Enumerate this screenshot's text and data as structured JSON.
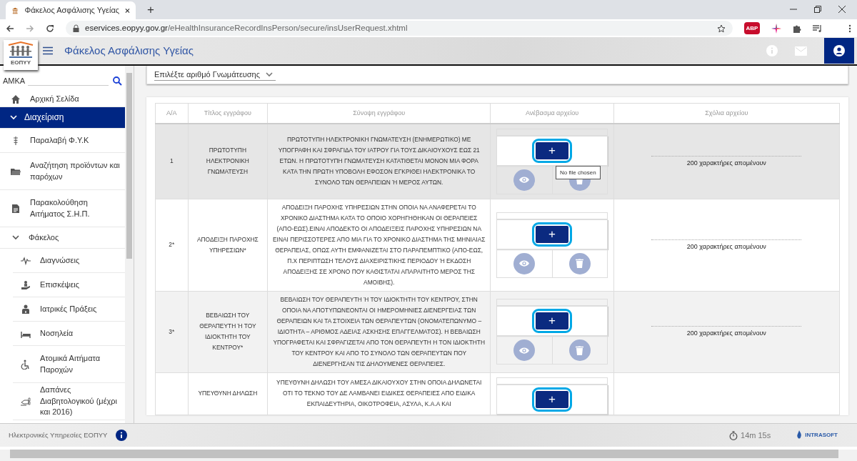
{
  "browser": {
    "tab_title": "Φάκελος Ασφάλισης Υγείας",
    "new_tab": "+",
    "url_domain": "eservices.eopyy.gov.gr",
    "url_path": "/eHealthInsuranceRecordInsPerson/secure/insUserRequest.xhtml",
    "extension_badge": "ABP"
  },
  "header": {
    "logo_text": "ΕΟΠΥΥ",
    "title": "Φάκελος Ασφάλισης Υγείας"
  },
  "sidebar": {
    "search_label": "ΑΜΚΑ",
    "items": [
      {
        "label": "Αρχική Σελίδα",
        "selected": false
      },
      {
        "label": "Διαχείριση",
        "selected": true,
        "expanded": true,
        "children": [
          {
            "label": "Παραλαβή Φ.Υ.Κ",
            "selected": false
          },
          {
            "label": "Αναζήτηση προϊόντων και παρόχων",
            "selected": false
          },
          {
            "label": "Παρακολούθηση Αιτήματος Σ.Η.Π.",
            "selected": false
          },
          {
            "label": "Φάκελος",
            "selected": false,
            "expanded": true,
            "children": [
              {
                "label": "Διαγνώσεις",
                "selected": false
              },
              {
                "label": "Επισκέψεις",
                "selected": false
              },
              {
                "label": "Ιατρικές Πράξεις",
                "selected": false
              },
              {
                "label": "Νοσηλεία",
                "selected": false
              },
              {
                "label": "Ατομικά Αιτήματα Παροχών",
                "selected": false
              },
              {
                "label": "Δαπάνες Διαβητολογικού (μέχρι και 2016)",
                "selected": false
              }
            ]
          }
        ]
      }
    ]
  },
  "referral_select": {
    "prompt": "Επιλέξτε αριθμό Γνωμάτευσης"
  },
  "table": {
    "columns": [
      "Α/Α",
      "Τίτλος εγγράφου",
      "Σύνοψη εγγράφου",
      "Ανέβασμα αρχείου",
      "Σχόλια αρχείου"
    ],
    "rows": [
      {
        "number": "1",
        "title": "ΠΡΩΤΟΤΥΠΗ ΗΛΕΚΤΡΟΝΙΚΗ ΓΝΩΜΑΤΕΥΣΗ",
        "summary": "ΠΡΩΤΟΤΥΠΗ ΗΛΕΚΤΡΟΝΙΚΗ ΓΝΩΜΑΤΕΥΣΗ (ΕΝΗΜΕΡΩΤΙΚΟ) ΜΕ ΥΠΟΓΡΑΦΗ ΚΑΙ ΣΦΡΑΓΙΔΑ ΤΟΥ ΙΑΤΡΟΥ ΓΙΑ ΤΟΥΣ ΔΙΚΑΙΟΥΧΟΥΣ ΕΩΣ 21 ΕΤΩΝ. Η ΠΡΩΤΟΤΥΠΗ ΓΝΩΜΑΤΕΥΣΗ ΚΑΤΑΤΙΘΕΤΑΙ ΜΟΝΟΝ ΜΙΑ ΦΟΡΑ ΚΑΤΑ ΤΗΝ ΠΡΩΤΗ ΥΠΟΒΟΛΗ ΕΦΟΣΟΝ ΕΓΚΡΙΘΕΙ ΗΛΕΚΤΡΟΝΙΚΑ ΤΟ ΣΥΝΟΛΟ ΤΩΝ ΘΕΡΑΠΕΙΩΝ Ή ΜΕΡΟΣ ΑΥΤΩΝ.",
        "selected": true,
        "upload": {
          "button_label": "+",
          "focused": true,
          "actions": true,
          "tooltip": "No file chosen"
        },
        "comment_counter": "200 χαρακτήρες απομένουν"
      },
      {
        "number": "2*",
        "title": "ΑΠΟΔΕΙΞΗ ΠΑΡΟΧΗΣ ΥΠΗΡΕΣΙΩΝ*",
        "summary": "ΑΠΟΔΕΙΞΗ ΠΑΡΟΧΗΣ ΥΠΗΡΕΣΙΩΝ ΣΤΗΝ ΟΠΟΙΑ ΝΑ ΑΝΑΦΕΡΕΤΑΙ ΤΟ ΧΡΟΝΙΚΟ ΔΙΑΣΤΗΜΑ ΚΑΤΑ ΤΟ ΟΠΟΙΟ ΧΟΡΗΓΗΘΗΚΑΝ ΟΙ ΘΕΡΑΠΕΙΕΣ (ΑΠΟ-ΕΩΣ).ΕΙΝΑΙ ΑΠΟΔΕΚΤΟ ΟΙ ΑΠΟΔΕΙΞΕΙΣ ΠΑΡΟΧΗΣ ΥΠΗΡΕΣΙΩΝ ΝΑ ΕΙΝΑΙ ΠΕΡΙΣΣΟΤΕΡΕΣ ΑΠΟ ΜΙΑ ΓΙΑ ΤΟ ΧΡΟΝΙΚΟ ΔΙΑΣΤΗΜΑ ΤΗΣ ΜΗΝΙΑΙΑΣ ΘΕΡΑΠΕΙΑΣ, ΟΠΩΣ ΑΥΤΗ ΕΜΦΑΝΙΖΕΤΑΙ ΣΤΟ ΠΑΡΑΠΕΜΠΤΙΚΟ (ΑΠΟ-ΕΩΣ, Π.Χ ΠΕΡΙΠΤΩΣΗ ΤΕΛΟΥΣ ΔΙΑΧΕΙΡΙΣΤΙΚΗΣ ΠΕΡΙΟΔΟΥ Ή ΕΚΔΟΣΗ ΑΠΟΔΕΙΞΗΣ ΣΕ ΧΡΟΝΟ ΠΟΥ ΚΑΘΙΣΤΑΤΑΙ ΑΠΑΡΑΙΤΗΤΟ ΜΕΡΟΣ ΤΗΣ ΑΜΟΙΒΗΣ).",
        "selected": false,
        "upload": {
          "button_label": "+",
          "focused": true,
          "actions": true
        },
        "comment_counter": "200 χαρακτήρες απομένουν"
      },
      {
        "number": "3*",
        "title": "ΒΕΒΑΙΩΣΗ ΤΟΥ ΘΕΡΑΠΕΥΤΗ Ή ΤΟΥ ΙΔΙΟΚΤΗΤΗ ΤΟΥ ΚΕΝΤΡΟΥ*",
        "summary": "ΒΕΒΑΙΩΣΗ ΤΟΥ ΘΕΡΑΠΕΥΤΗ Ή ΤΟΥ ΙΔΙΟΚΤΗΤΗ ΤΟΥ ΚΕΝΤΡΟΥ, ΣΤΗΝ ΟΠΟΙΑ ΝΑ ΑΠΟΤΥΠΩΝΕΟΝΤΑΙ ΟΙ ΗΜΕΡΟΜΗΝΙΕΣ ΔΙΕΝΕΡΓΕΙΑΣ ΤΩΝ ΘΕΡΑΠΕΙΩΝ ΚΑΙ ΤΑ ΣΤΟΙΧΕΙΑ ΤΩΝ ΘΕΡΑΠΕΥΤΩΝ (ΟΝΟΜΑΤΕΠΩΝΥΜΟ – ΙΔΙΟΤΗΤΑ – ΑΡΙΘΜΟΣ ΑΔΕΙΑΣ ΑΣΚΗΣΗΣ ΕΠΑΓΓΕΛΜΑΤΟΣ). Η ΒΕΒΑΙΩΣΗ ΥΠΟΓΡΑΦΕΤΑΙ ΚΑΙ ΣΦΡΑΓΙΖΕΤΑΙ ΑΠΟ ΤΟΝ ΘΕΡΑΠΕΥΤΗ Η ΤΟΝ ΙΔΙΟΚΤΗΤΗ ΤΟΥ ΚΕΝΤΡΟΥ ΚΑΙ ΑΠΟ ΤΟ ΣΥΝΟΛΟ ΤΩΝ ΘΕΡΑΠΕΥΤΩΝ ΠΟΥ ΔΙΕΝΕΡΓΗΣΑΝ ΤΙΣ ΔΗΛΟΥΜΕΝΕΣ ΘΕΡΑΠΕΙΕΣ.",
        "selected": false,
        "upload": {
          "button_label": "+",
          "focused": true,
          "actions": true
        },
        "comment_counter": "200 χαρακτήρες απομένουν"
      },
      {
        "title": "ΥΠΕΥΘΥΝΗ ΔΗΛΩΣΗ",
        "summary": "ΥΠΕΥΘΥΝΗ ΔΗΛΩΣΗ ΤΟΥ ΑΜΕΣΑ ΔΙΚΑΙΟΥΧΟΥ ΣΤΗΝ ΟΠΟΙΑ ΔΗΛΩΝΕΤΑΙ ΟΤΙ ΤΟ ΤΕΚΝΟ ΤΟΥ ΔΕ ΛΑΜΒΑΝΕΙ ΕΙΔΙΚΕΣ ΘΕΡΑΠΕΙΕΣ ΑΠΟ ΕΙΔΙΚΑ ΕΚΠΑΙΔΕΥΤΗΡΙΑ, ΟΙΚΟΤΡΟΦΕΙΑ, ΑΣΥΛΑ, Κ.Α.Α ΚΑΙ",
        "selected": false,
        "upload": {
          "button_label": "+",
          "focused": true,
          "actions": false
        }
      }
    ]
  },
  "footer": {
    "service_name": "Ηλεκτρονικές Υπηρεσίες ΕΟΠΥΥ",
    "session_timer": "14m 15s",
    "vendor_logo": "INTRASOFT"
  }
}
